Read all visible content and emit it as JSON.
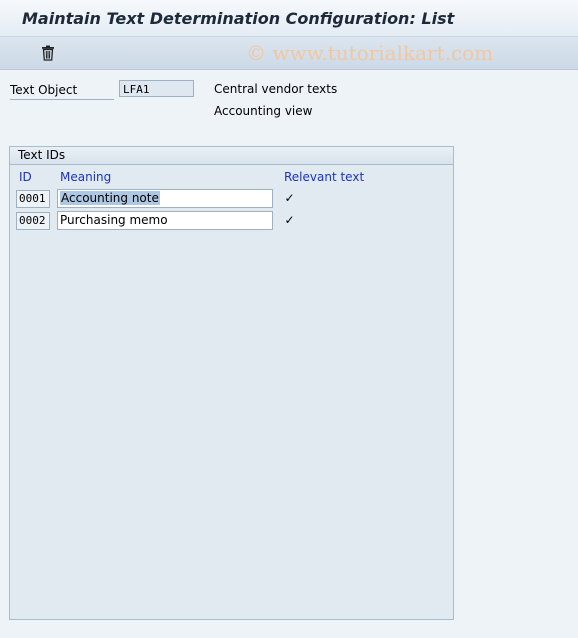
{
  "window": {
    "title": "Maintain Text Determination Configuration: List",
    "watermark": "© www.tutorialkart.com"
  },
  "toolbar": {
    "delete_icon": "trash-icon"
  },
  "header": {
    "text_object_label": "Text Object",
    "text_object_value": "LFA1",
    "description_line1": "Central vendor texts",
    "description_line2": "Accounting view"
  },
  "text_ids": {
    "title": "Text IDs",
    "columns": {
      "id": "ID",
      "meaning": "Meaning",
      "relevant": "Relevant text"
    },
    "rows": [
      {
        "id": "0001",
        "meaning": "Accounting note",
        "relevant": true,
        "selected": true
      },
      {
        "id": "0002",
        "meaning": "Purchasing memo",
        "relevant": true,
        "selected": false
      }
    ]
  },
  "colors": {
    "background": "#eef3f8",
    "column_header": "#1a33c7",
    "selection": "#aec8e4"
  }
}
